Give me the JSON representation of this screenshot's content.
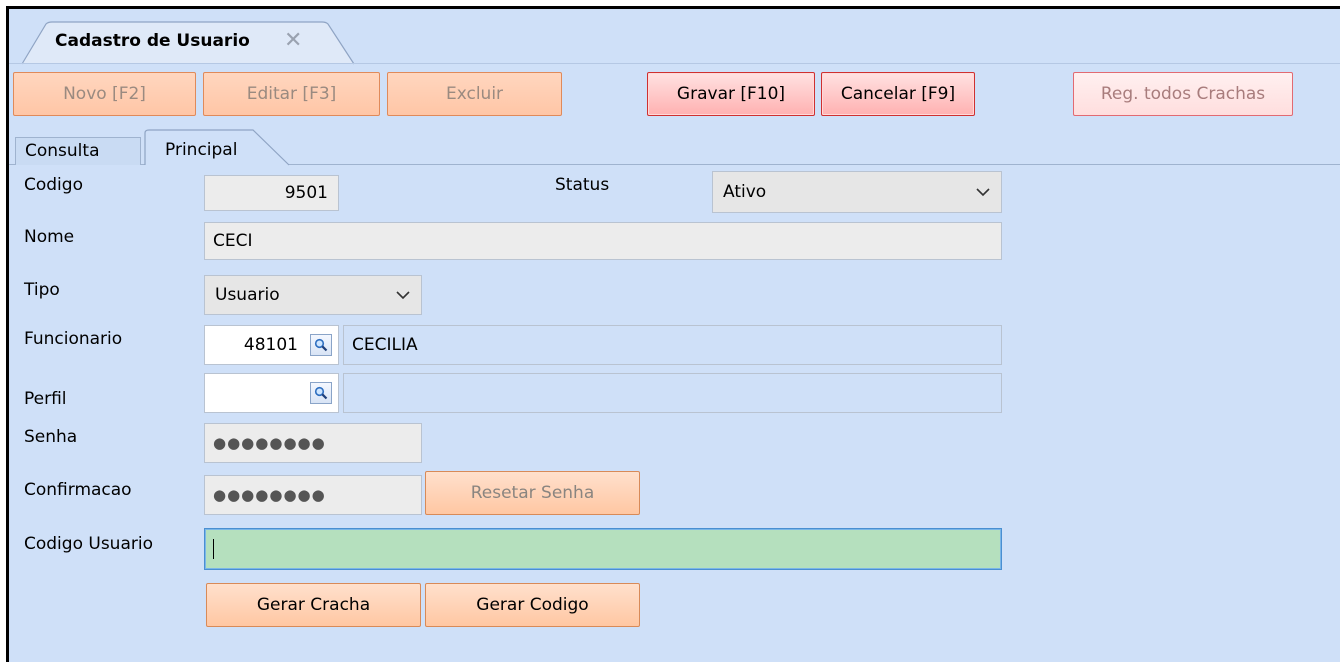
{
  "window": {
    "tab_title": "Cadastro de Usuario",
    "tab_close_symbol": "✕"
  },
  "toolbar": {
    "novo": "Novo [F2]",
    "editar": "Editar [F3]",
    "excluir": "Excluir",
    "gravar": "Gravar [F10]",
    "cancelar": "Cancelar [F9]",
    "reg_todos_crachas": "Reg. todos Crachas"
  },
  "tabs": {
    "consulta": "Consulta",
    "principal": "Principal"
  },
  "form": {
    "codigo": {
      "label": "Codigo",
      "value": "9501"
    },
    "status": {
      "label": "Status",
      "value": "Ativo"
    },
    "nome": {
      "label": "Nome",
      "value": "CECI"
    },
    "tipo": {
      "label": "Tipo",
      "value": "Usuario"
    },
    "funcionario": {
      "label": "Funcionario",
      "code": "48101",
      "name": "CECILIA"
    },
    "perfil": {
      "label": "Perfil",
      "code": "",
      "name": ""
    },
    "senha": {
      "label": "Senha",
      "value": "●●●●●●●●"
    },
    "confirmacao": {
      "label": "Confirmacao",
      "value": "●●●●●●●●"
    },
    "resetar_senha": "Resetar Senha",
    "codigo_usuario": {
      "label": "Codigo Usuario",
      "value": ""
    },
    "gerar_cracha": "Gerar Cracha",
    "gerar_codigo": "Gerar Codigo"
  },
  "icons": {
    "lookup": "magnifier-icon",
    "dropdown": "chevron-down-icon",
    "close": "close-icon"
  },
  "colors": {
    "background": "#cfe0f8",
    "focus_field": "#b5e0be",
    "orange_button": "#ffc7a3",
    "red_button_border": "#cf3030"
  }
}
